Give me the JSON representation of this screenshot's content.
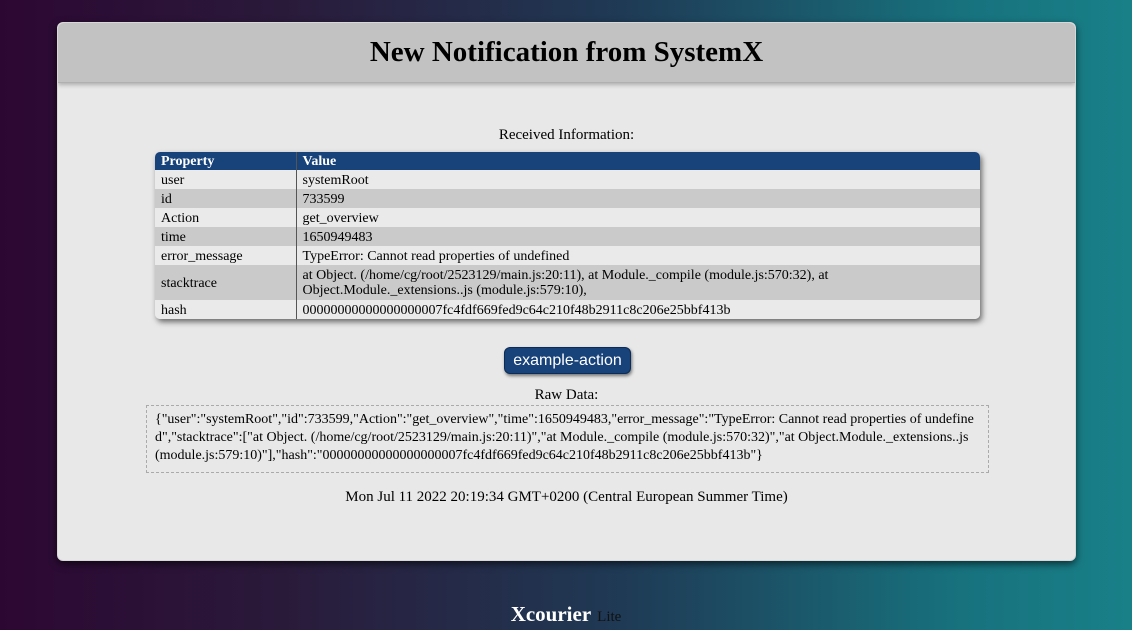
{
  "header": {
    "title": "New Notification from SystemX"
  },
  "info": {
    "label": "Received Information:",
    "columns": [
      "Property",
      "Value"
    ],
    "rows": [
      {
        "property": "user",
        "value": "systemRoot"
      },
      {
        "property": "id",
        "value": "733599"
      },
      {
        "property": "Action",
        "value": "get_overview"
      },
      {
        "property": "time",
        "value": "1650949483"
      },
      {
        "property": "error_message",
        "value": "TypeError: Cannot read properties of undefined"
      },
      {
        "property": "stacktrace",
        "value": "at Object. (/home/cg/root/2523129/main.js:20:11), at Module._compile (module.js:570:32), at Object.Module._extensions..js (module.js:579:10),"
      },
      {
        "property": "hash",
        "value": "00000000000000000007fc4fdf669fed9c64c210f48b2911c8c206e25bbf413b"
      }
    ]
  },
  "action_button": {
    "label": "example-action"
  },
  "raw": {
    "label": "Raw Data:",
    "text": "{\"user\":\"systemRoot\",\"id\":733599,\"Action\":\"get_overview\",\"time\":1650949483,\"error_message\":\"TypeError: Cannot read properties of undefined\",\"stacktrace\":[\"at Object. (/home/cg/root/2523129/main.js:20:11)\",\"at Module._compile (module.js:570:32)\",\"at Object.Module._extensions..js (module.js:579:10)\"],\"hash\":\"00000000000000000007fc4fdf669fed9c64c210f48b2911c8c206e25bbf413b\"}"
  },
  "timestamp": "Mon Jul 11 2022 20:19:34 GMT+0200 (Central European Summer Time)",
  "footer": {
    "brand": "Xcourier",
    "edition": "Lite"
  }
}
